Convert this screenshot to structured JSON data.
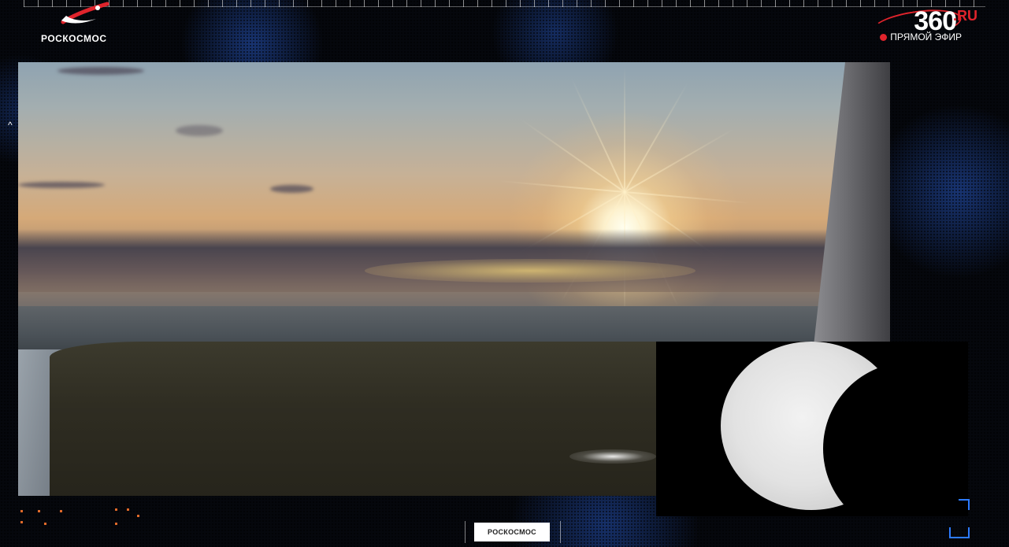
{
  "header": {
    "brand_name": "РОСКОСМОС",
    "channel_logo": "360",
    "channel_suffix": ".RU",
    "live_label": "ПРЯМОЙ ЭФИР"
  },
  "footer": {
    "tab_label": "РОСКОСМОС"
  },
  "icons": {
    "brand": "roscosmos-logo",
    "live": "live-dot",
    "side": "chevron-up-icon"
  },
  "colors": {
    "accent_red": "#e0242c",
    "background": "#05070c",
    "pattern_blue": "#285ac8"
  }
}
